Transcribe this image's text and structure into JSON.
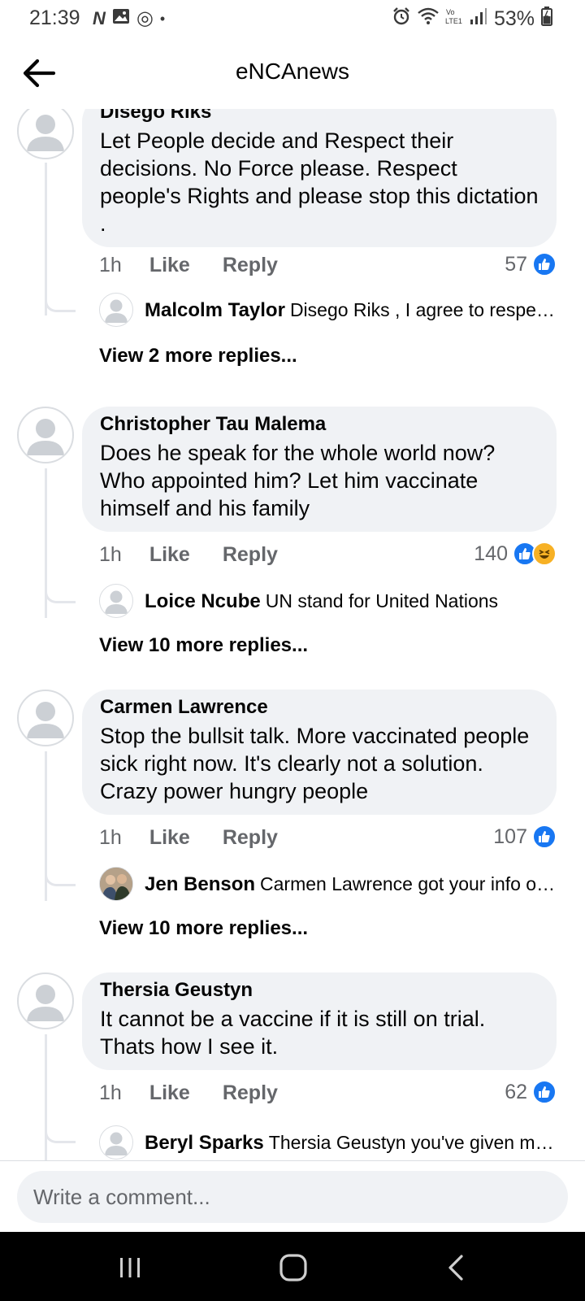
{
  "status_bar": {
    "time": "21:39",
    "left_icons": [
      "netflix-icon",
      "gallery-icon",
      "instagram-icon",
      "dot-icon"
    ],
    "netflix_glyph": "N",
    "instagram_glyph": "◎",
    "dot_glyph": "•",
    "right_icons": [
      "alarm-icon",
      "wifi-icon",
      "volte-icon",
      "signal-icon",
      "battery-icon"
    ],
    "battery": "53%"
  },
  "header": {
    "title": "eNCAnews"
  },
  "comments": [
    {
      "author": "Disego Riks",
      "text": "Let People decide and Respect their decisions. No Force please. Respect people's Rights and please stop this dictation .",
      "time": "1h",
      "like_label": "Like",
      "reply_label": "Reply",
      "reaction_count": "57",
      "reactions": [
        "like"
      ],
      "reply_preview": {
        "author": "Malcolm Taylor",
        "text": "Disego Riks , I agree to respect ..."
      },
      "view_more": "View 2 more replies..."
    },
    {
      "author": "Christopher Tau Malema",
      "text": "Does he speak for the whole world now? Who appointed him? Let him vaccinate himself and his family",
      "time": "1h",
      "like_label": "Like",
      "reply_label": "Reply",
      "reaction_count": "140",
      "reactions": [
        "like",
        "haha"
      ],
      "reply_preview": {
        "author": "Loice Ncube",
        "text": "UN stand for United Nations"
      },
      "view_more": "View 10 more replies..."
    },
    {
      "author": "Carmen Lawrence",
      "text": "Stop the bullsit talk. More vaccinated people sick right now. It's clearly not a solution. Crazy power hungry people",
      "time": "1h",
      "like_label": "Like",
      "reply_label": "Reply",
      "reaction_count": "107",
      "reactions": [
        "like"
      ],
      "reply_preview": {
        "author": "Jen Benson",
        "text": "Carmen Lawrence got your info off..."
      },
      "view_more": "View 10 more replies..."
    },
    {
      "author": "Thersia Geustyn",
      "text": "It cannot be a vaccine if it is still on trial. Thats how I see it.",
      "time": "1h",
      "like_label": "Like",
      "reply_label": "Reply",
      "reaction_count": "62",
      "reactions": [
        "like"
      ],
      "reply_preview": {
        "author": "Beryl Sparks",
        "text": "Thersia Geustyn you've given me f..."
      }
    }
  ],
  "composer": {
    "placeholder": "Write a comment..."
  },
  "nav_bar": {
    "buttons": [
      "recent-apps",
      "home",
      "back"
    ]
  },
  "colors": {
    "bubble": "#f0f2f5",
    "like_blue": "#1877f2",
    "secondary_text": "#65676b",
    "haha_yellow": "#f7b125"
  }
}
